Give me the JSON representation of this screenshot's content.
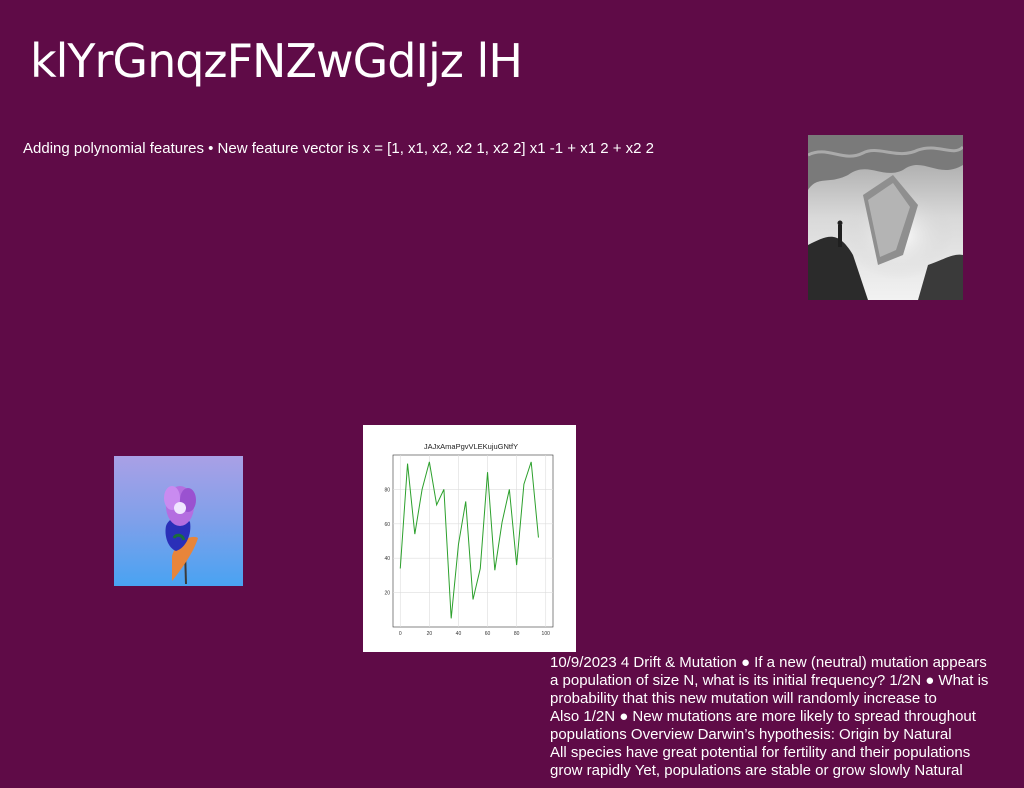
{
  "slide": {
    "title": "klYrGnqzFNZwGdIjz lH",
    "subtitle": "Adding polynomial features • New feature vector is x = [1, x1, x2, x2 1, x2 2] x1 -1 + x1 2 + x2 2",
    "background_color": "#5f0b47",
    "body_lines": [
      "10/9/2023 4 Drift & Mutation ● If a new (neutral) mutation appears",
      "a population of size N, what is its initial frequency? 1/2N ● What is",
      "probability that this new mutation will randomly increase to",
      "Also 1/2N ● New mutations are more likely to spread throughout",
      "populations Overview Darwin’s hypothesis: Origin by Natural",
      "All species have great potential for fertility and their populations",
      "grow rapidly Yet, populations are stable or grow slowly Natural"
    ]
  },
  "images": {
    "ice_cave_photo": "grayscale-ice-cave-photo",
    "flower_photo": "purple-flower-on-blue-photo"
  },
  "chart_data": {
    "type": "line",
    "title": "JAJxAmaPgvVLEKujuGNtfY",
    "xlabel": "",
    "ylabel": "",
    "x": [
      0,
      5,
      10,
      15,
      20,
      25,
      30,
      35,
      40,
      45,
      50,
      55,
      60,
      65,
      70,
      75,
      80,
      85,
      90,
      95,
      100
    ],
    "series": [
      {
        "values": [
          34,
          95,
          54,
          80,
          96,
          71,
          80,
          5,
          48,
          73,
          16,
          34,
          90,
          33,
          61,
          80,
          36,
          83,
          96,
          52
        ]
      }
    ],
    "x_values": [
      0,
      5,
      10,
      15,
      20,
      25,
      30,
      35,
      40,
      45,
      50,
      55,
      60,
      65,
      70,
      75,
      80,
      85,
      90,
      95
    ],
    "xticks": [
      0,
      20,
      40,
      60,
      80,
      100
    ],
    "yticks": [
      20,
      40,
      60,
      80
    ],
    "xlim": [
      -5,
      105
    ],
    "ylim": [
      0,
      100
    ],
    "grid": true,
    "line_color": "#2ca02c"
  }
}
